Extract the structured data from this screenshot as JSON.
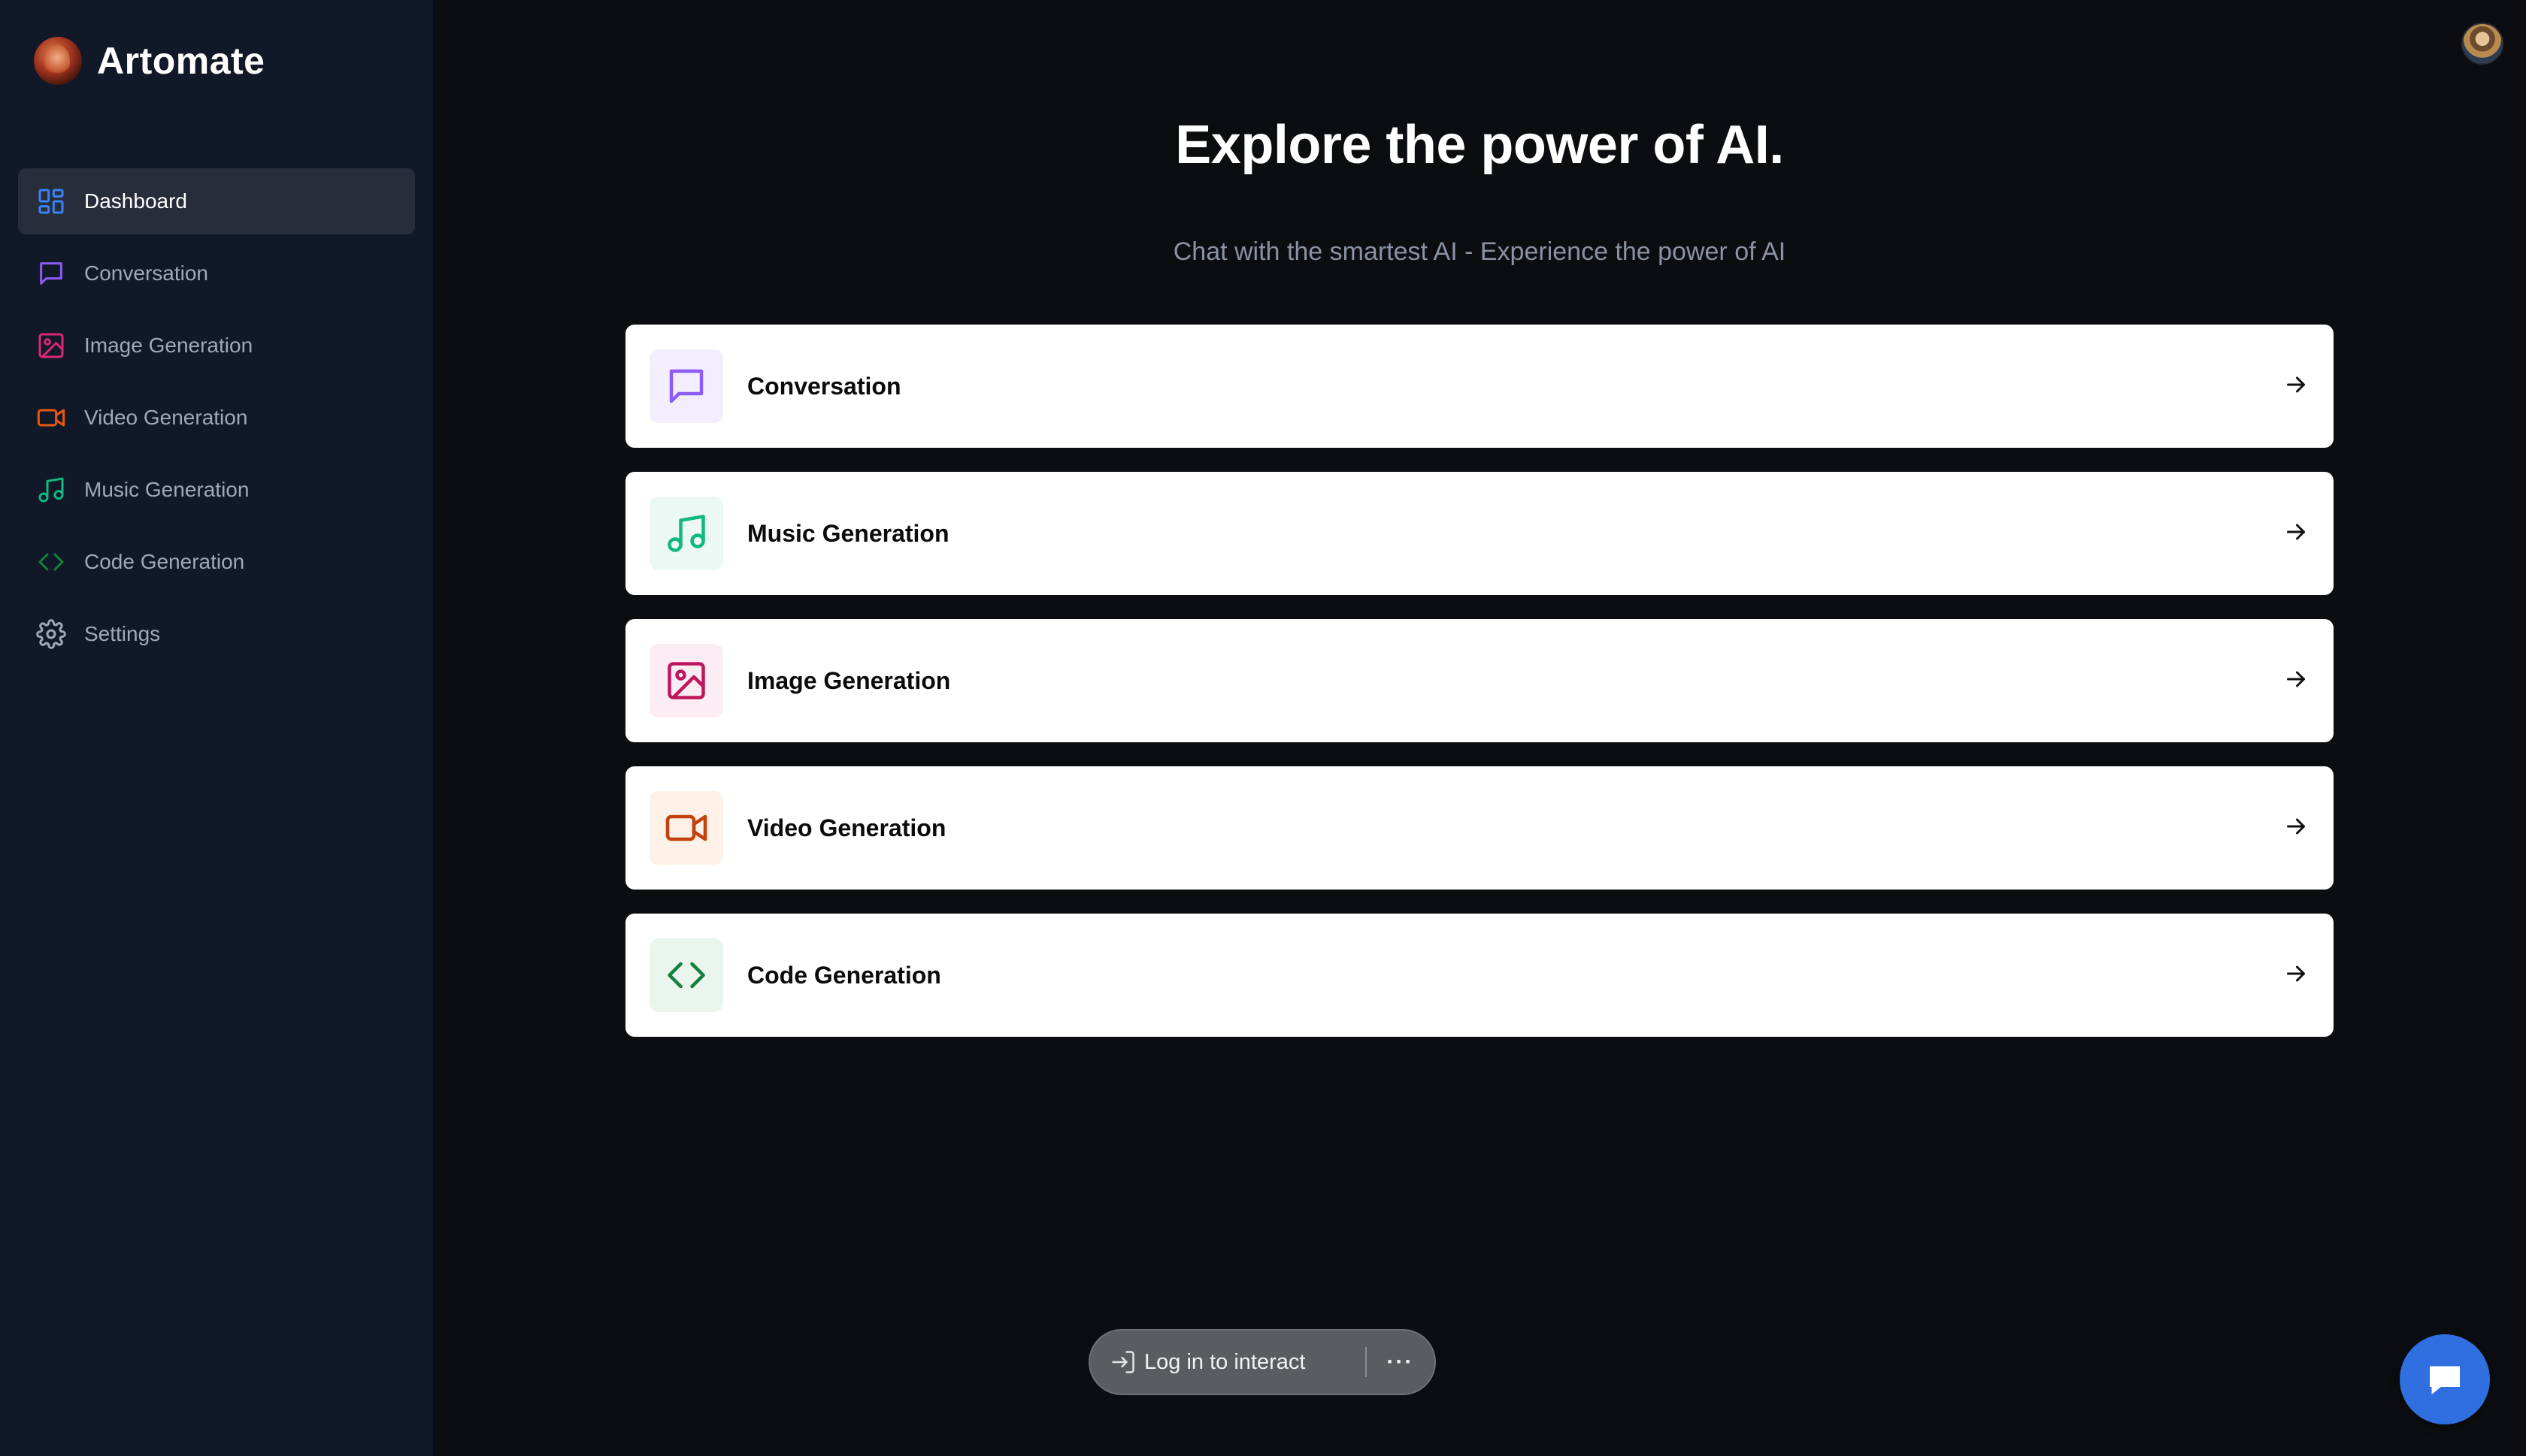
{
  "brand": {
    "name": "Artomate"
  },
  "sidebar": {
    "items": [
      {
        "label": "Dashboard",
        "icon": "dashboard-icon",
        "color": "#3b82f6",
        "active": true
      },
      {
        "label": "Conversation",
        "icon": "chat-icon",
        "color": "#8b5cf6",
        "active": false
      },
      {
        "label": "Image Generation",
        "icon": "image-icon",
        "color": "#db2777",
        "active": false
      },
      {
        "label": "Video Generation",
        "icon": "video-icon",
        "color": "#ea580c",
        "active": false
      },
      {
        "label": "Music Generation",
        "icon": "music-icon",
        "color": "#10b981",
        "active": false
      },
      {
        "label": "Code Generation",
        "icon": "code-icon",
        "color": "#15803d",
        "active": false
      },
      {
        "label": "Settings",
        "icon": "gear-icon",
        "color": "#a1a8b6",
        "active": false
      }
    ]
  },
  "header": {
    "title": "Explore the power of AI.",
    "subtitle": "Chat with the smartest AI - Experience the power of AI"
  },
  "tools": [
    {
      "label": "Conversation",
      "icon": "chat-icon",
      "color": "#8b5cf6",
      "bg": "#f3eefe"
    },
    {
      "label": "Music Generation",
      "icon": "music-icon",
      "color": "#10b981",
      "bg": "#ebf8f3"
    },
    {
      "label": "Image Generation",
      "icon": "image-icon",
      "color": "#be185d",
      "bg": "#fcecf3"
    },
    {
      "label": "Video Generation",
      "icon": "video-icon",
      "color": "#c2410c",
      "bg": "#fdf1e8"
    },
    {
      "label": "Code Generation",
      "icon": "code-icon",
      "color": "#15803d",
      "bg": "#eaf5ed"
    }
  ],
  "overlay": {
    "login_label": "Log in to interact",
    "more_label": "···"
  },
  "icons": {
    "avatar": "user-avatar",
    "chat_support": "chat-support-icon",
    "arrow": "arrow-right-icon"
  }
}
